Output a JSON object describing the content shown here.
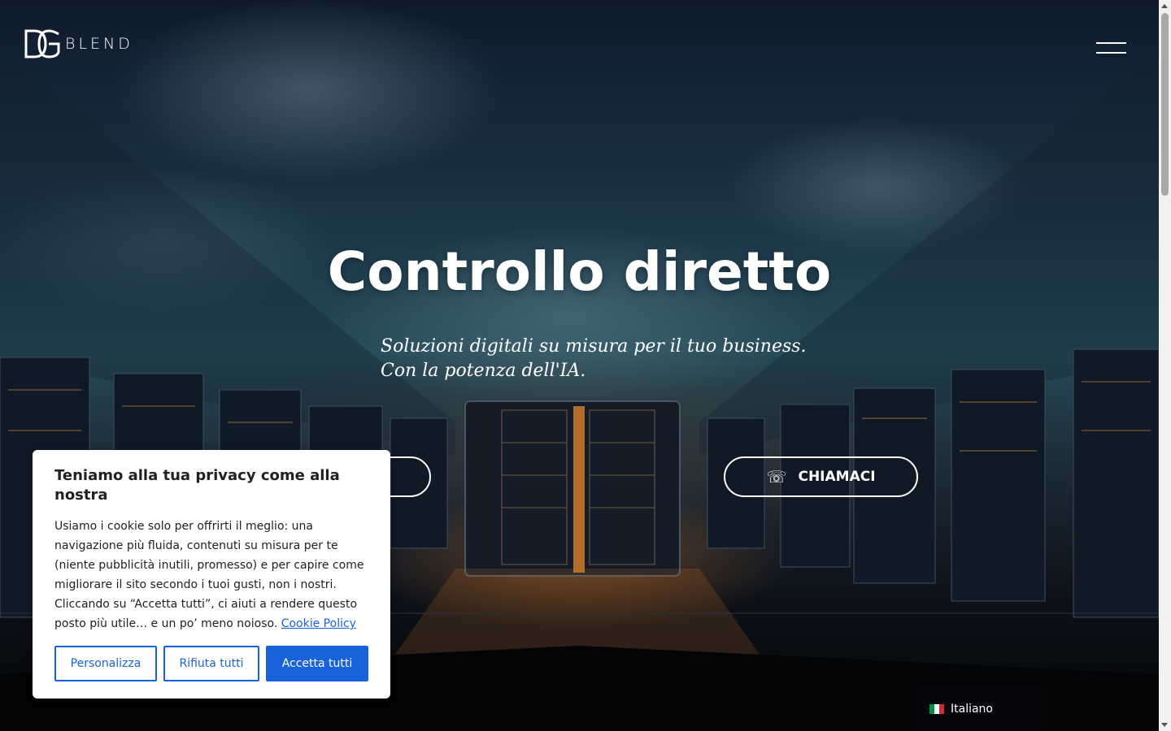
{
  "header": {
    "logo_text": "BLEND",
    "logo_mark": "DG",
    "menu_icon": "hamburger-menu-icon"
  },
  "hero": {
    "title": "Controllo diretto",
    "subtitle_line1": "Soluzioni digitali su misura per il tuo business.",
    "subtitle_line2": "Con la potenza dell'IA.",
    "call_button": "CHIAMACI",
    "call_icon": "phone-icon"
  },
  "cookie_banner": {
    "title": "Teniamo alla tua privacy come alla nostra",
    "body": "Usiamo i cookie solo per offrirti il meglio: una navigazione più fluida, contenuti su misura per te (niente pubblicità inutili, promesso) e per capire come migliorare il sito secondo i tuoi gusti, non i nostri. Cliccando su “Accetta tutti”, ci aiuti a rendere questo posto più utile… e un po’ meno noioso. ",
    "icon_glyph": "",
    "link_text": "Cookie Policy",
    "btn_customize": "Personalizza",
    "btn_reject": "Rifiuta tutti",
    "btn_accept": "Accetta tutti",
    "accent_color": "#1863dc"
  },
  "language": {
    "label": "Italiano",
    "flag_icon": "italy-flag-icon"
  }
}
